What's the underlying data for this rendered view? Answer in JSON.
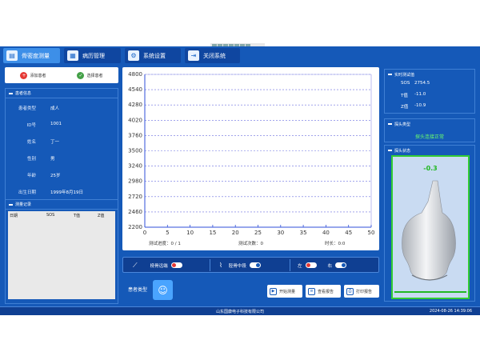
{
  "nav": {
    "tabs": [
      {
        "label": "骨密度测量",
        "icon": "bone-density-icon",
        "active": true
      },
      {
        "label": "病历管理",
        "icon": "clipboard-icon",
        "active": false
      },
      {
        "label": "系统设置",
        "icon": "gear-icon",
        "active": false
      },
      {
        "label": "关闭系统",
        "icon": "exit-icon",
        "active": false
      }
    ]
  },
  "patient_actions": {
    "add": "添加患者",
    "select": "选择患者"
  },
  "patient_info": {
    "title": "患者信息",
    "rows": [
      {
        "label": "患者类型",
        "value": "成人"
      },
      {
        "label": "ID号",
        "value": "1001"
      },
      {
        "label": "姓名",
        "value": "丁一"
      },
      {
        "label": "性别",
        "value": "男"
      },
      {
        "label": "年龄",
        "value": "25岁"
      },
      {
        "label": "出生日期",
        "value": "1999年8月19日"
      }
    ]
  },
  "records": {
    "title": "测量记录",
    "columns": [
      "日期",
      "SOS",
      "T值",
      "Z值"
    ]
  },
  "chart_data": {
    "type": "line",
    "title": "",
    "xlabel": "",
    "ylabel": "",
    "xlim": [
      0,
      50
    ],
    "ylim": [
      2200,
      4800
    ],
    "x_ticks": [
      0,
      5,
      10,
      15,
      20,
      25,
      30,
      35,
      40,
      45,
      50
    ],
    "y_ticks": [
      2200,
      2460,
      2720,
      2980,
      3240,
      3500,
      3760,
      4020,
      4280,
      4540,
      4800
    ],
    "grid": "horizontal-dashed",
    "series": []
  },
  "measure_status": {
    "progress": "测试进度：0 / 1",
    "count": "测试次数：0",
    "duration": "时长：0:0"
  },
  "toggles": {
    "site1": "桡骨远端",
    "site2": "胫骨中段",
    "left": "左",
    "right": "右"
  },
  "patient_type_label": "患者类型",
  "actions": {
    "start": "开始测量",
    "view_report": "查看报告",
    "print_report": "打印报告"
  },
  "live": {
    "title": "实时测试值",
    "rows": [
      {
        "label": "SOS",
        "value": "2754.5"
      },
      {
        "label": "T值",
        "value": "-11.0"
      },
      {
        "label": "Z值",
        "value": "-10.9"
      }
    ]
  },
  "probe_type": {
    "title": "探头类型",
    "message": "探头连接正常"
  },
  "probe_state": {
    "title": "探头状态",
    "reading": "-0.3"
  },
  "footer": {
    "company": "山东国康电子科技有限公司",
    "datetime": "2024-08-26 14:39:06"
  },
  "colors": {
    "app_bg": "#1559b8",
    "ok_green": "#22b822",
    "alert_red": "#e53935"
  }
}
